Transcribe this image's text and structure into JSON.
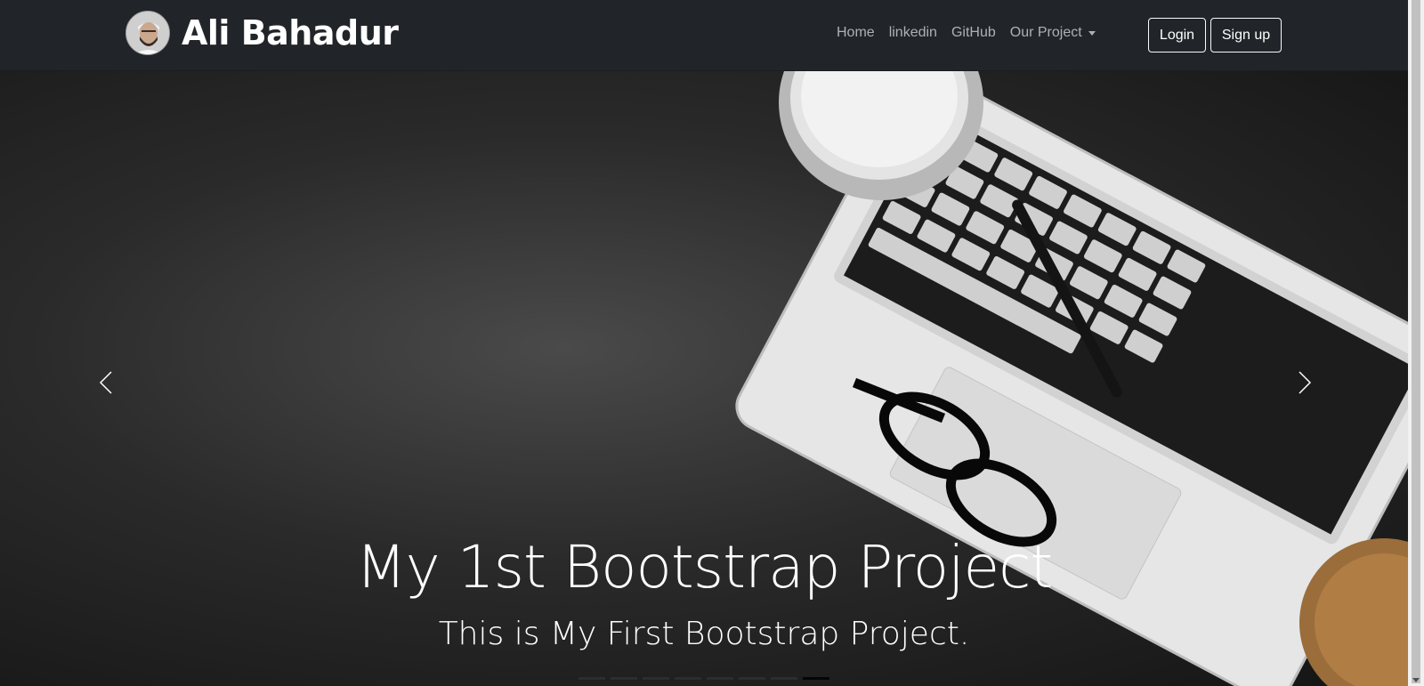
{
  "navbar": {
    "brand_name": "Ali Bahadur",
    "links": [
      {
        "label": "Home"
      },
      {
        "label": "linkedin"
      },
      {
        "label": "GitHub"
      },
      {
        "label": "Our Project"
      }
    ],
    "login_label": "Login",
    "signup_label": "Sign up"
  },
  "carousel": {
    "caption_title": "My 1st Bootstrap Project",
    "caption_subtitle": "This is My First Bootstrap Project.",
    "indicator_count": 8,
    "active_indicator": 8,
    "prev_icon": "chevron-left-icon",
    "next_icon": "chevron-right-icon"
  },
  "colors": {
    "navbar_bg": "#212529",
    "nav_link": "#aeb0b3",
    "text_light": "#ffffff"
  }
}
